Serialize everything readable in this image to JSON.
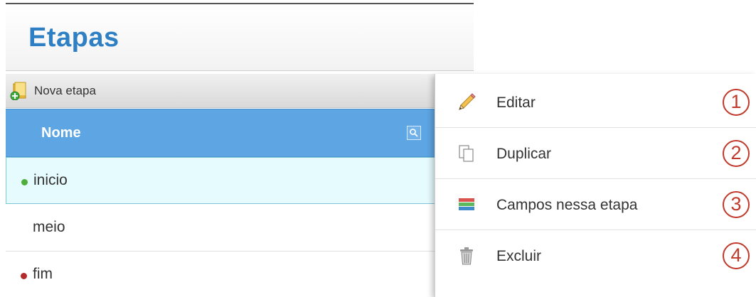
{
  "page": {
    "title": "Etapas"
  },
  "toolbar": {
    "new_stage_label": "Nova etapa",
    "new_stage_icon": "folder-add-icon"
  },
  "table": {
    "column_header": "Nome",
    "filter_icon": "search-icon",
    "rows": [
      {
        "name": "inicio",
        "marker_color": "#4caf3a",
        "selected": true
      },
      {
        "name": "meio",
        "marker_color": "",
        "selected": false
      },
      {
        "name": "fim",
        "marker_color": "#b42b2b",
        "selected": false
      }
    ]
  },
  "context_menu": {
    "items": [
      {
        "label": "Editar",
        "icon": "pencil-icon",
        "badge": "1"
      },
      {
        "label": "Duplicar",
        "icon": "copy-icon",
        "badge": "2"
      },
      {
        "label": "Campos nessa etapa",
        "icon": "fields-icon",
        "badge": "3"
      },
      {
        "label": "Excluir",
        "icon": "trash-icon",
        "badge": "4"
      }
    ]
  },
  "colors": {
    "title": "#2f7fc4",
    "header_bg": "#5da5e3",
    "selected_row_bg": "#e6fbfd",
    "badge": "#c0392b"
  }
}
